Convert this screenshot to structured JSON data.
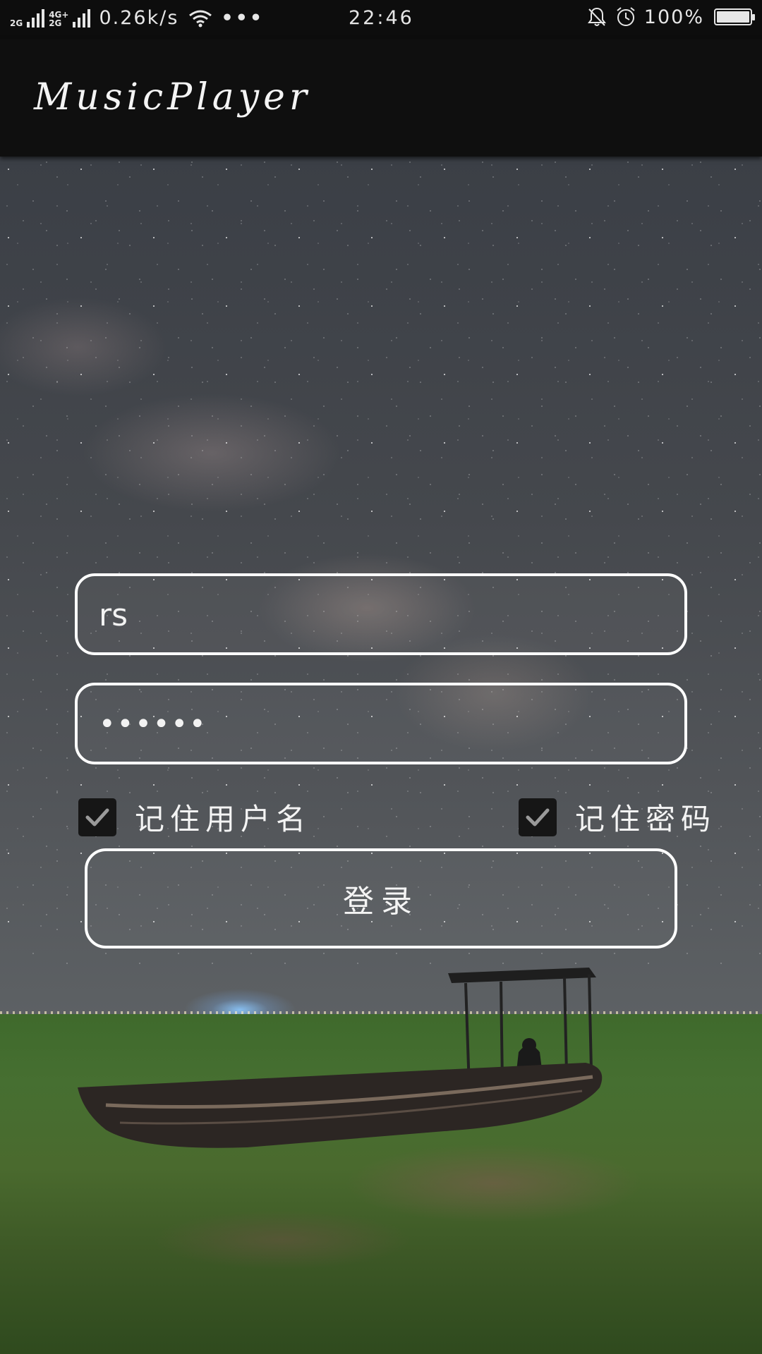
{
  "status_bar": {
    "network_1": "2G",
    "network_2a": "4G+",
    "network_2b": "2G",
    "speed": "0.26k/s",
    "more": "•••",
    "time": "22:46",
    "battery_percent": "100%",
    "battery_level": 1.0
  },
  "app_bar": {
    "title": "MusicPlayer"
  },
  "login_form": {
    "username_value": "rs",
    "password_value": "••••••",
    "remember_username_label": "记住用户名",
    "remember_username_checked": true,
    "remember_password_label": "记住密码",
    "remember_password_checked": true,
    "login_button_label": "登录"
  },
  "icons": {
    "wifi": "wifi-icon",
    "mute": "bell-off-icon",
    "alarm": "alarm-icon",
    "battery": "battery-icon",
    "check": "check-icon"
  },
  "colors": {
    "app_bar_bg": "#0f0f0f",
    "field_border": "#ffffff",
    "checkbox_bg": "#161616"
  }
}
